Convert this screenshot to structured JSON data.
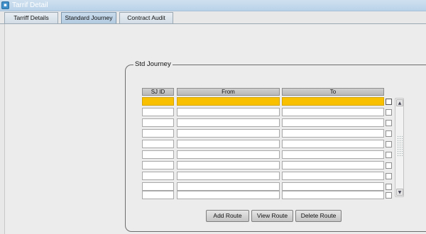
{
  "window": {
    "title": "Tarrif Detail"
  },
  "tabs": [
    {
      "label": "Tarriff Details",
      "active": false
    },
    {
      "label": "Standard Journey",
      "active": true
    },
    {
      "label": "Contract Audit",
      "active": false
    }
  ],
  "std_journey": {
    "title": "Std Journey",
    "columns": [
      "SJ ID",
      "From",
      "To"
    ],
    "rows": [
      {
        "sj_id": "",
        "from": "",
        "to": "",
        "selected": true
      },
      {
        "sj_id": "",
        "from": "",
        "to": "",
        "selected": false
      },
      {
        "sj_id": "",
        "from": "",
        "to": "",
        "selected": false
      },
      {
        "sj_id": "",
        "from": "",
        "to": "",
        "selected": false
      },
      {
        "sj_id": "",
        "from": "",
        "to": "",
        "selected": false
      },
      {
        "sj_id": "",
        "from": "",
        "to": "",
        "selected": false
      },
      {
        "sj_id": "",
        "from": "",
        "to": "",
        "selected": false
      },
      {
        "sj_id": "",
        "from": "",
        "to": "",
        "selected": false
      },
      {
        "sj_id": "",
        "from": "",
        "to": "",
        "selected": false
      },
      {
        "sj_id": "",
        "from": "",
        "to": "",
        "selected": false
      }
    ],
    "buttons": {
      "add_route": "Add Route",
      "view_route": "View Route",
      "delete_route": "Delete Route"
    }
  },
  "colors": {
    "selected_row": "#f9c000",
    "title_bar": "#c4d9ec"
  },
  "icons": {
    "window": "form-icon",
    "scroll_up": "arrow-up-icon",
    "scroll_down": "arrow-down-icon"
  }
}
